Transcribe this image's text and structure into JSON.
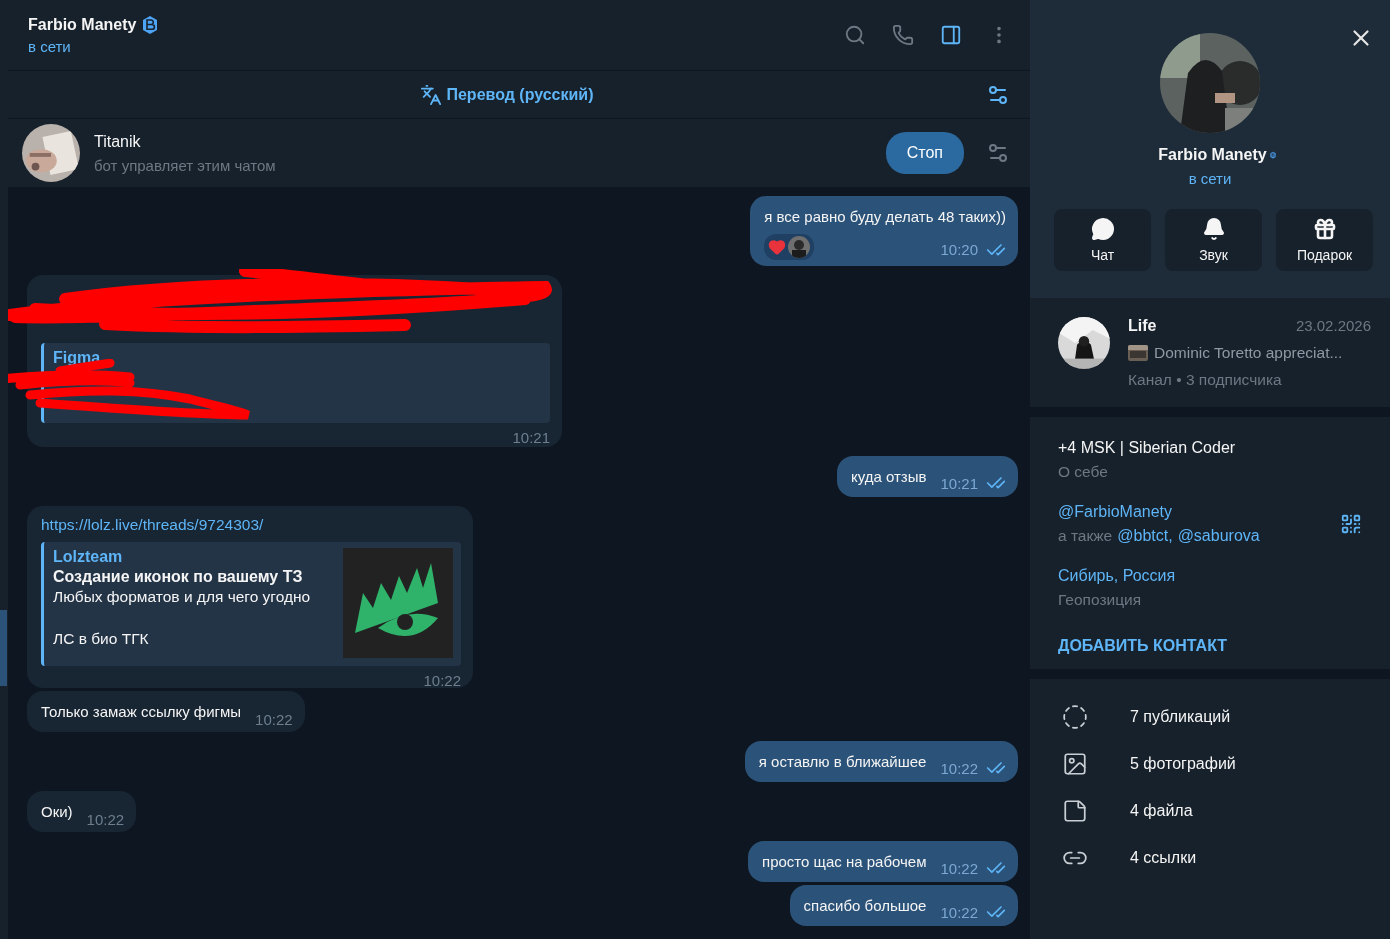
{
  "header": {
    "title": "Farbio Manety",
    "status": "в сети"
  },
  "translate_bar": {
    "label": "Перевод (русский)"
  },
  "bot_bar": {
    "name": "Titanik",
    "subtitle": "бот управляет этим чатом",
    "button": "Стоп"
  },
  "messages": [
    {
      "outgoing": true,
      "kind": "text",
      "text": "я все равно буду делать 48 таких))",
      "time": "10:20",
      "read": true,
      "reactions": [
        {
          "kind": "heart"
        },
        {
          "kind": "avatar"
        }
      ]
    },
    {
      "outgoing": false,
      "kind": "redacted_preview",
      "preview_title": "Figma",
      "time": "10:21"
    },
    {
      "outgoing": true,
      "kind": "text",
      "text": "куда отзыв",
      "time": "10:21",
      "read": true
    },
    {
      "outgoing": false,
      "kind": "link_preview",
      "link": "https://lolz.live/threads/9724303/",
      "site": "Lolzteam",
      "title": "Создание иконок по вашему ТЗ",
      "description": "Любых форматов и для чего угодно",
      "footer": "ЛС в био ТГК",
      "time": "10:22"
    },
    {
      "outgoing": false,
      "kind": "text",
      "text": "Только замаж ссылку фигмы",
      "time": "10:22"
    },
    {
      "outgoing": true,
      "kind": "text",
      "text": "я оставлю в ближайшее",
      "time": "10:22",
      "read": true
    },
    {
      "outgoing": false,
      "kind": "text",
      "text": "Оки)",
      "time": "10:22"
    },
    {
      "outgoing": true,
      "kind": "text",
      "text": "просто щас на рабочем",
      "time": "10:22",
      "read": true
    },
    {
      "outgoing": true,
      "kind": "text",
      "text": "спасибо большое",
      "time": "10:22",
      "read": true
    }
  ],
  "profile": {
    "name": "Farbio Manety",
    "status": "в сети",
    "actions": [
      {
        "kind": "chat",
        "label": "Чат"
      },
      {
        "kind": "bell",
        "label": "Звук"
      },
      {
        "kind": "gift",
        "label": "Подарок"
      }
    ]
  },
  "channel": {
    "name": "Life",
    "date": "23.02.2026",
    "preview": "Dominic Toretto appreciat...",
    "meta": "Канал • 3 подписчика"
  },
  "info": {
    "bio": "+4 MSK | Siberian Coder",
    "bio_label": "О себе",
    "username": "@FarbioManety",
    "also_prefix": "а также",
    "also_usernames": [
      "@bbtct,",
      "@saburova"
    ],
    "location": "Сибирь, Россия",
    "location_label": "Геопозиция",
    "add_contact": "ДОБАВИТЬ КОНТАКТ"
  },
  "media": [
    {
      "kind": "stories",
      "label": "7 публикаций"
    },
    {
      "label": "5 фотографий"
    },
    {
      "kind": "file",
      "label": "4 файла"
    },
    {
      "kind": "link",
      "label": "4 ссылки"
    }
  ]
}
